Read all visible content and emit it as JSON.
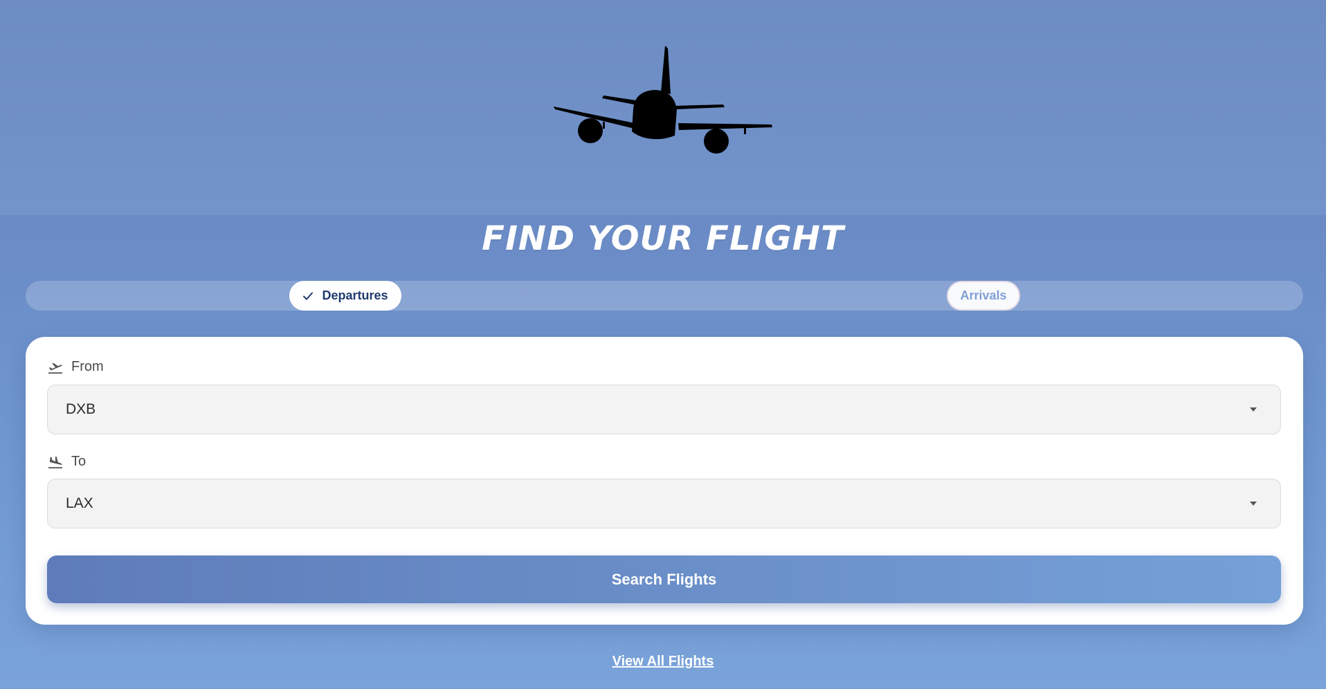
{
  "page": {
    "title": "FIND YOUR FLIGHT"
  },
  "tabs": {
    "departures_label": "Departures",
    "arrivals_label": "Arrivals",
    "active": "Departures"
  },
  "form": {
    "from_label": "From",
    "from_value": "DXB",
    "to_label": "To",
    "to_value": "LAX",
    "search_label": "Search Flights"
  },
  "footer": {
    "view_all_label": "View All Flights"
  },
  "icons": {
    "hero": "airplane-silhouette-icon",
    "active_tab": "check-icon",
    "from": "flight-takeoff-icon",
    "to": "flight-land-icon",
    "select": "chevron-down-icon"
  },
  "colors": {
    "background": "#6a8ac4",
    "card": "#ffffff",
    "active_tab_text": "#1f3a6e",
    "inactive_tab_text": "#7fa0d6",
    "button_start": "#5e7cba",
    "button_end": "#76a0d8"
  }
}
